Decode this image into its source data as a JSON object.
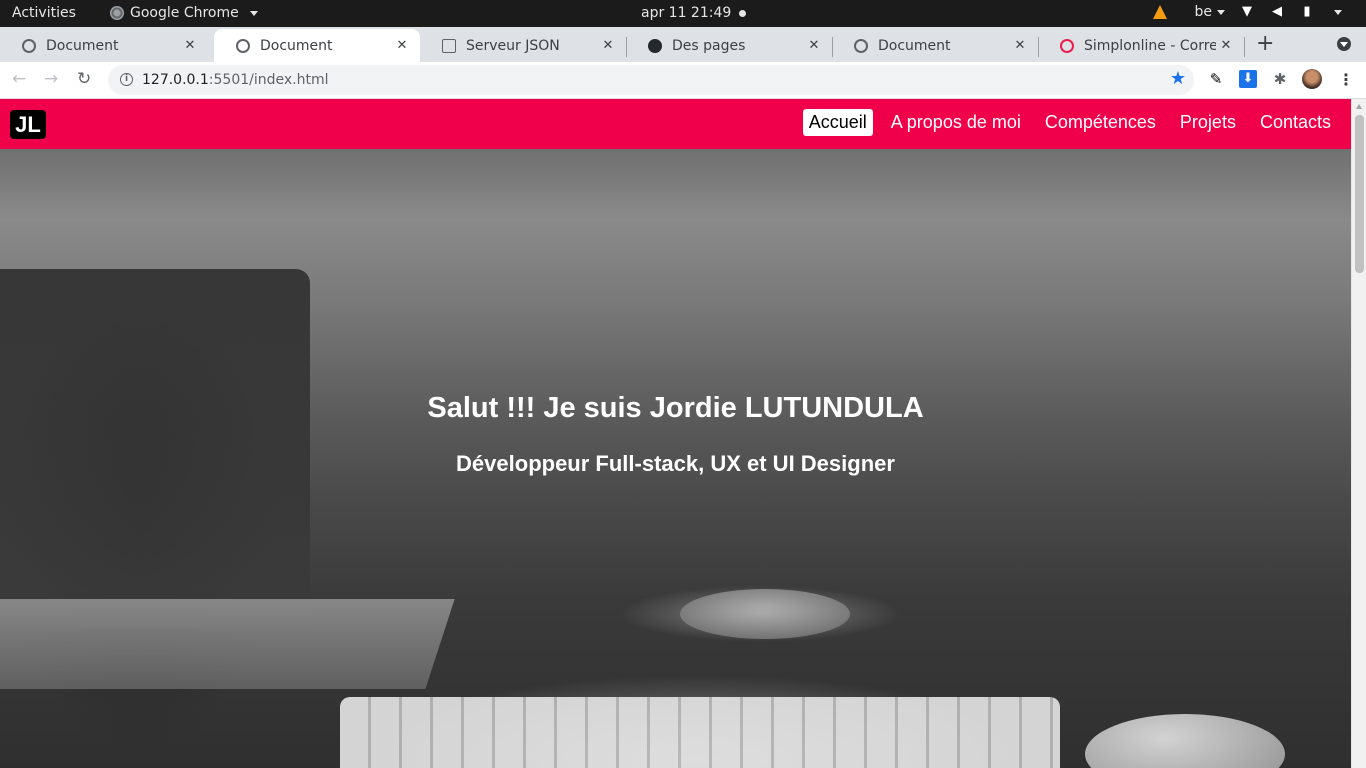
{
  "system_bar": {
    "activities": "Activities",
    "app_name": "Google Chrome",
    "clock": "apr 11  21:49",
    "keyboard_layout": "be"
  },
  "tabs": [
    {
      "title": "Document",
      "favicon": "globe-icon",
      "active": false
    },
    {
      "title": "Document",
      "favicon": "globe-icon",
      "active": true
    },
    {
      "title": "Serveur JSON",
      "favicon": "json-icon",
      "active": false
    },
    {
      "title": "Des pages",
      "favicon": "github-icon",
      "active": false
    },
    {
      "title": "Document",
      "favicon": "globe-icon",
      "active": false
    },
    {
      "title": "Simplonline - Correct",
      "favicon": "simplon-icon",
      "active": false
    }
  ],
  "toolbar": {
    "url_host": "127.0.0.1",
    "url_rest": ":5501/index.html"
  },
  "site": {
    "logo": "JL",
    "nav": [
      {
        "label": "Accueil",
        "active": true
      },
      {
        "label": "A propos de moi",
        "active": false
      },
      {
        "label": "Compétences",
        "active": false
      },
      {
        "label": "Projets",
        "active": false
      },
      {
        "label": "Contacts",
        "active": false
      }
    ],
    "headline": "Salut !!! Je suis Jordie LUTUNDULA",
    "subline": "Développeur Full-stack, UX et UI Designer"
  },
  "colors": {
    "navbar": "#f0004a",
    "tab_strip": "#dee1e6",
    "accent_blue": "#1a73e8"
  }
}
